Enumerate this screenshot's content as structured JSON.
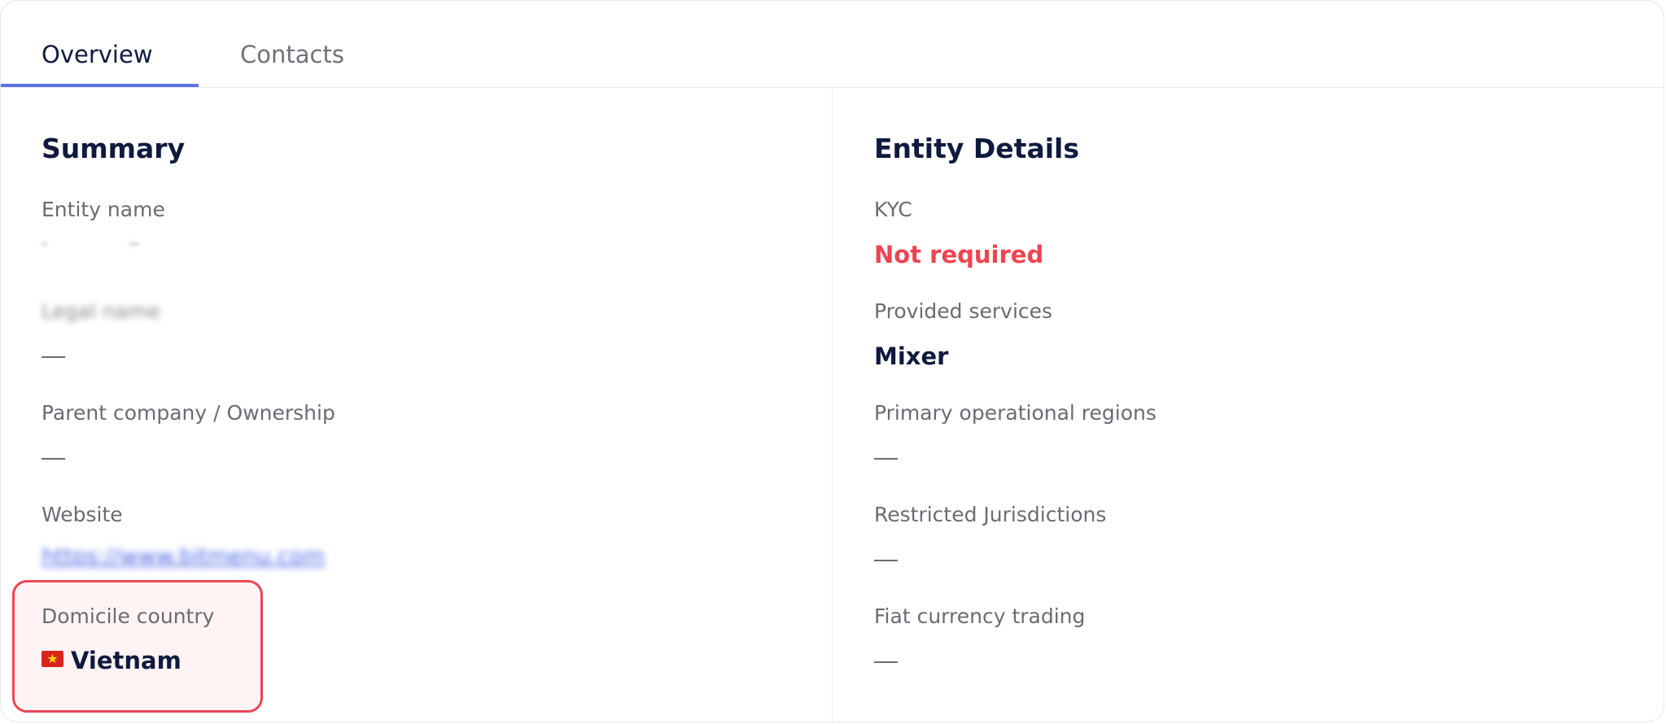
{
  "tabs": [
    {
      "label": "Overview",
      "active": true
    },
    {
      "label": "Contacts",
      "active": false
    }
  ],
  "summary": {
    "title": "Summary",
    "entity_name": {
      "label": "Entity name",
      "value": ""
    },
    "legal_name": {
      "label": "Legal name",
      "value": "—"
    },
    "parent_company": {
      "label": "Parent company / Ownership",
      "value": "—"
    },
    "website": {
      "label": "Website",
      "value": "https://www.bitmenu.com"
    },
    "domicile_country": {
      "label": "Domicile country",
      "value": "Vietnam",
      "flag_icon": "vietnam-flag-icon"
    }
  },
  "entity_details": {
    "title": "Entity Details",
    "kyc": {
      "label": "KYC",
      "value": "Not required"
    },
    "provided_services": {
      "label": "Provided services",
      "value": "Mixer"
    },
    "operational_regions": {
      "label": "Primary operational regions",
      "value": "—"
    },
    "restricted_jurisdictions": {
      "label": "Restricted Jurisdictions",
      "value": "—"
    },
    "fiat_trading": {
      "label": "Fiat currency trading",
      "value": "—"
    }
  },
  "colors": {
    "accent": "#5b73e8",
    "text_primary": "#0f1a3e",
    "text_secondary": "#6a6b73",
    "alert": "#ee4452",
    "highlight_border": "#ea4654",
    "highlight_bg": "#fff3f3"
  }
}
